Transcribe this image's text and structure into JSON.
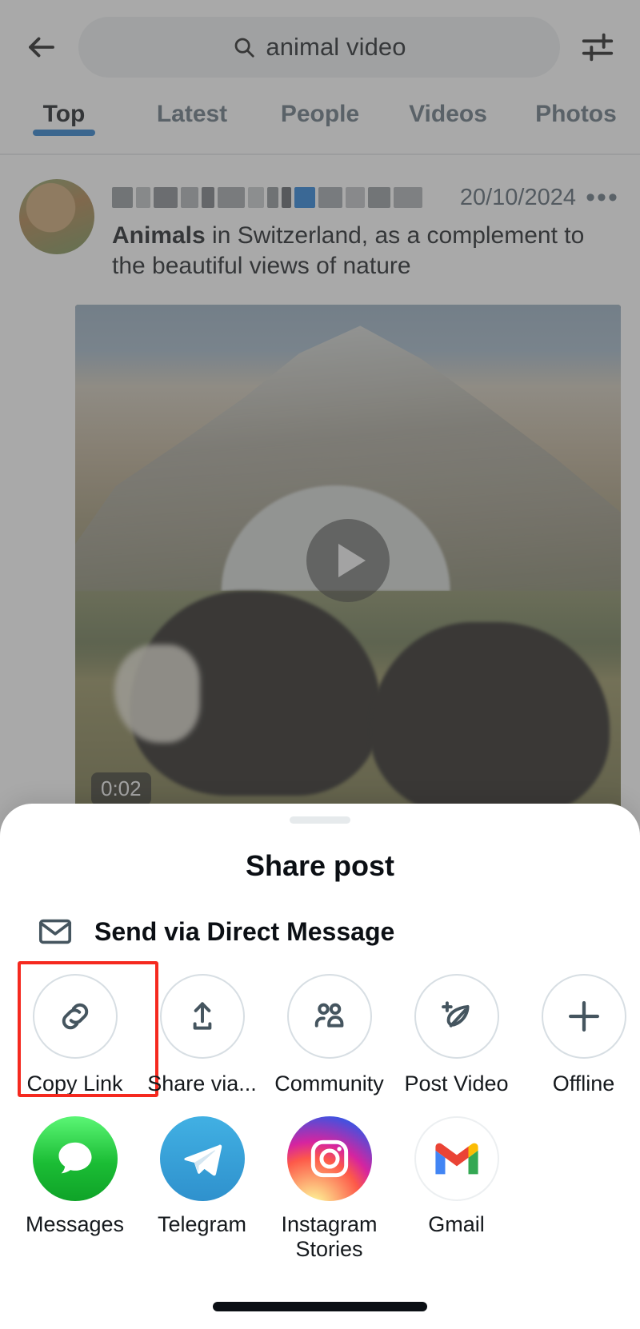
{
  "search": {
    "query": "animal video",
    "back_icon": "arrow-left-icon",
    "search_icon": "search-icon",
    "filter_icon": "sliders-filter-icon"
  },
  "tabs": [
    {
      "label": "Top",
      "active": true
    },
    {
      "label": "Latest",
      "active": false
    },
    {
      "label": "People",
      "active": false
    },
    {
      "label": "Videos",
      "active": false
    },
    {
      "label": "Photos",
      "active": false
    }
  ],
  "post": {
    "author_redacted": true,
    "date": "20/10/2024",
    "more_icon": "more-horizontal-icon",
    "text_bold": "Animals",
    "text_rest": " in Switzerland, as a complement to the beautiful views of nature",
    "video": {
      "duration": "0:02",
      "play_icon": "play-icon"
    }
  },
  "share_sheet": {
    "title": "Share post",
    "dm": {
      "icon": "envelope-icon",
      "label": "Send via Direct Message"
    },
    "actions": [
      {
        "label": "Copy Link",
        "icon": "link-icon",
        "highlighted": true
      },
      {
        "label": "Share via...",
        "icon": "share-up-icon",
        "highlighted": false
      },
      {
        "label": "Community",
        "icon": "people-icon",
        "highlighted": false
      },
      {
        "label": "Post Video",
        "icon": "feather-plus-icon",
        "highlighted": false
      },
      {
        "label": "Offline",
        "icon": "plus-icon",
        "highlighted": false
      }
    ],
    "apps": [
      {
        "label": "Messages",
        "icon": "messages-app-icon",
        "color": "#1bbd35"
      },
      {
        "label": "Telegram",
        "icon": "telegram-app-icon",
        "color": "#2f91cd"
      },
      {
        "label": "Instagram Stories",
        "icon": "instagram-app-icon",
        "color": "#d6249f"
      },
      {
        "label": "Gmail",
        "icon": "gmail-app-icon",
        "color": "#ea4335"
      }
    ]
  },
  "colors": {
    "accent": "#1a73c7",
    "highlight": "#f5291f",
    "icon_stroke": "#45555f"
  },
  "system": {
    "home_indicator": "home-indicator"
  }
}
